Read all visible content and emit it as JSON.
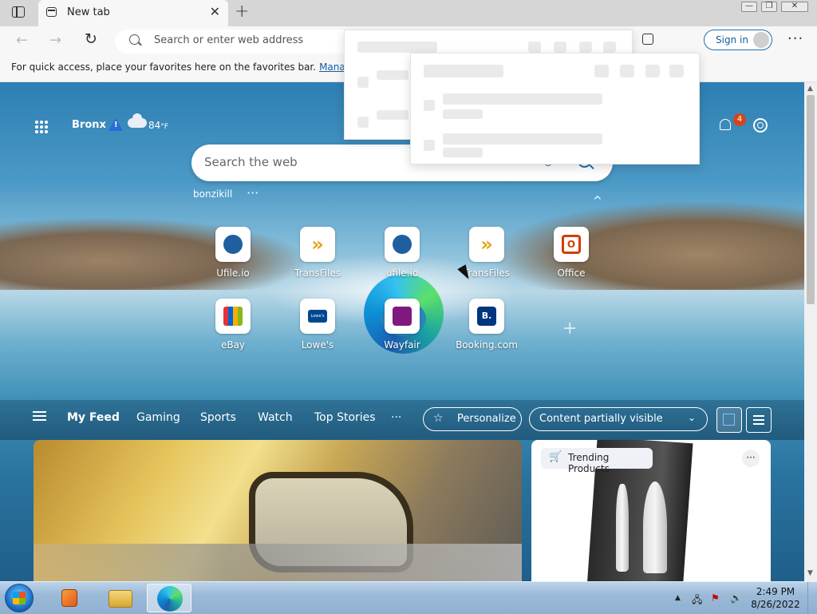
{
  "browser": {
    "tab": {
      "title": "New tab",
      "close": "✕"
    },
    "new_tab_symbol": "+",
    "window_controls": {
      "minimize": "—",
      "maximize": "❐",
      "close": "✕"
    },
    "address_bar": {
      "placeholder": "Search or enter web address"
    },
    "sign_in": "Sign in",
    "more_menu": "···"
  },
  "favorites_bar": {
    "message": "For quick access, place your favorites here on the favorites bar.",
    "manage_link": "Manage favo"
  },
  "new_tab_page": {
    "weather": {
      "location": "Bronx",
      "temperature": "84",
      "unit": "°F",
      "alert_symbol": "!"
    },
    "notifications": {
      "count": "4"
    },
    "search": {
      "placeholder": "Search the web"
    },
    "user_label": "bonzikill",
    "user_more": "···",
    "collapse_symbol": "^",
    "quick_links": [
      {
        "label": "Ufile.io",
        "icon": "ufile-icon"
      },
      {
        "label": "TransFiles",
        "icon": "transfiles-icon"
      },
      {
        "label": "ufile.io",
        "icon": "ufile-icon"
      },
      {
        "label": "TransFiles",
        "icon": "transfiles-icon"
      },
      {
        "label": "Office",
        "icon": "office-icon"
      },
      {
        "label": "eBay",
        "icon": "ebay-icon"
      },
      {
        "label": "Lowe's",
        "icon": "lowes-icon"
      },
      {
        "label": "Wayfair",
        "icon": "wayfair-icon"
      },
      {
        "label": "Booking.com",
        "icon": "booking-icon"
      }
    ],
    "tile_glyphs": {
      "transfiles": "»",
      "office": "O",
      "lowes": "Lowe's",
      "booking": "B."
    },
    "add_tile_symbol": "+",
    "feed_tabs": [
      "My Feed",
      "Gaming",
      "Sports",
      "Watch",
      "Top Stories"
    ],
    "feed_more": "···",
    "personalize": "Personalize",
    "content_visibility": "Content partially visible",
    "cards": {
      "trending_label": "Trending Products",
      "card_more": "···"
    }
  },
  "taskbar": {
    "time": "2:49 PM",
    "date": "8/26/2022",
    "tray_expand": "▲"
  },
  "colors": {
    "accent": "#115ea3",
    "badge": "#d64518"
  }
}
